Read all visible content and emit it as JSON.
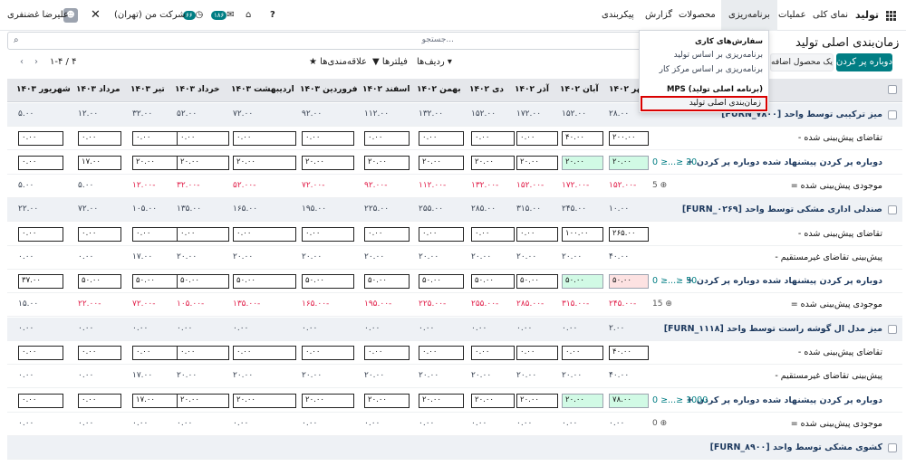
{
  "topbar": {
    "app_name": "تولید",
    "menus": [
      "نمای کلی",
      "عملیات",
      "برنامه‌ریزی",
      "محصولات",
      "گزارش",
      "پیکربندی"
    ],
    "user": "علیرضا غضنفری",
    "company": "شرکت من (تهران)",
    "badge_activity": "۶۶",
    "badge_msgs": "۱۸۶"
  },
  "page": {
    "title": "زمان‌بندی اصلی تولید",
    "search_placeholder": "جستجو...",
    "replenish_button": "دوباره پر کردن",
    "add_product_button": "یک محصول اضافه",
    "rows_label": "ردیف‌ها",
    "filters_label": "فیلترها",
    "favorites_label": "علاقه‌مندی‌ها",
    "pager": "۱-۴ / ۴"
  },
  "dropdown": {
    "header1": "سفارش‌های کاری",
    "item1": "برنامه‌ریزی بر اساس تولید",
    "item2": "برنامه‌ریزی بر اساس مرکز کار",
    "header2": "MPS (برنامه اصلی تولید)",
    "item3": "زمان‌بندی اصلی تولید"
  },
  "months": [
    "بهمن ۱۴۰۲",
    "آبان ۱۴۰۲",
    "آذر ۱۴۰۲",
    "دی ۱۴۰۲",
    "بهمن ۱۴۰۲",
    "اسفند ۱۴۰۲",
    "فروردین ۱۴۰۳",
    "اردیبهشت ۱۴۰۳",
    "خرداد ۱۴۰۳",
    "تیر ۱۴۰۳",
    "مرداد ۱۴۰۳",
    "شهریور ۱۴۰۳"
  ],
  "month0_visible": "مهر ۱۴۰۲",
  "rows": [
    {
      "type": "prod",
      "label": "[FURN_۷۸۰۰] میز ترکیبی توسط واحد",
      "values": [
        "۲۸.۰۰",
        "۱۵۲.۰۰",
        "۱۷۲.۰۰",
        "۱۵۲.۰۰",
        "۱۳۲.۰۰",
        "۱۱۲.۰۰",
        "۹۲.۰۰",
        "۷۲.۰۰",
        "۵۲.۰۰",
        "۳۲.۰۰",
        "۱۲.۰۰",
        "۵.۰۰"
      ]
    },
    {
      "type": "input",
      "label": "- تقاضای پیش‌بینی شده",
      "values": [
        "۲۰۰.۰۰",
        "۴۰.۰۰",
        "۰.۰۰",
        "۰.۰۰",
        "۰.۰۰",
        "۰.۰۰",
        "۰.۰۰",
        "۰.۰۰",
        "۰.۰۰",
        "۰.۰۰",
        "۰.۰۰",
        "۰.۰۰"
      ]
    },
    {
      "type": "repl",
      "label": "+ دوباره پر کردن پیشنهاد شده دوباره پر کردن",
      "minrep": "0 ≥...≥ 20",
      "values": [
        "۲۰.۰۰",
        "۲۰.۰۰",
        "۲۰.۰۰",
        "۲۰.۰۰",
        "۲۰.۰۰",
        "۲۰.۰۰",
        "۲۰.۰۰",
        "۲۰.۰۰",
        "۲۰.۰۰",
        "۲۰.۰۰",
        "۱۷.۰۰",
        "۰.۰۰"
      ],
      "style": [
        "green",
        "green",
        "",
        "",
        "",
        "",
        "",
        "",
        "",
        "",
        "",
        ""
      ]
    },
    {
      "type": "stock",
      "label": "= موجودی پیش‌بینی شده",
      "safety": "5",
      "values": [
        "۱۵۲.۰۰-",
        "۱۷۲.۰۰-",
        "۱۵۲.۰۰-",
        "۱۳۲.۰۰-",
        "۱۱۲.۰۰-",
        "۹۲.۰۰-",
        "۷۲.۰۰-",
        "۵۲.۰۰-",
        "۳۲.۰۰-",
        "۱۲.۰۰-",
        "۵.۰۰",
        "۵.۰۰"
      ],
      "red": [
        true,
        true,
        true,
        true,
        true,
        true,
        true,
        true,
        true,
        true,
        false,
        false
      ]
    },
    {
      "type": "prod",
      "label": "[FURN_۰۲۶۹] صندلی اداری مشکی توسط واحد",
      "values": [
        "۱۰.۰۰",
        "۲۴۵.۰۰",
        "۳۱۵.۰۰",
        "۲۸۵.۰۰",
        "۲۵۵.۰۰",
        "۲۲۵.۰۰",
        "۱۹۵.۰۰",
        "۱۶۵.۰۰",
        "۱۳۵.۰۰",
        "۱۰۵.۰۰",
        "۷۲.۰۰",
        "۲۲.۰۰"
      ]
    },
    {
      "type": "input",
      "label": "- تقاضای پیش‌بینی شده",
      "values": [
        "۲۶۵.۰۰",
        "۱۰۰.۰۰",
        "۰.۰۰",
        "۰.۰۰",
        "۰.۰۰",
        "۰.۰۰",
        "۰.۰۰",
        "۰.۰۰",
        "۰.۰۰",
        "۰.۰۰",
        "۰.۰۰",
        "۰.۰۰"
      ]
    },
    {
      "type": "text",
      "label": "- پیش‌بینی تقاضای غیرمستقیم",
      "values": [
        "۴۰.۰۰",
        "۲۰.۰۰",
        "۲۰.۰۰",
        "۲۰.۰۰",
        "۲۰.۰۰",
        "۲۰.۰۰",
        "۲۰.۰۰",
        "۲۰.۰۰",
        "۲۰.۰۰",
        "۱۷.۰۰",
        "۰.۰۰",
        "۰.۰۰"
      ]
    },
    {
      "type": "repl",
      "label": "+ دوباره پر کردن پیشنهاد شده دوباره پر کردن",
      "minrep": "0 ≥...≥ 50",
      "values": [
        "۵۰.۰۰",
        "۵۰.۰۰",
        "۵۰.۰۰",
        "۵۰.۰۰",
        "۵۰.۰۰",
        "۵۰.۰۰",
        "۵۰.۰۰",
        "۵۰.۰۰",
        "۵۰.۰۰",
        "۵۰.۰۰",
        "۵۰.۰۰",
        "۳۷.۰۰"
      ],
      "style": [
        "pink",
        "green",
        "",
        "",
        "",
        "",
        "",
        "",
        "",
        "",
        "",
        ""
      ]
    },
    {
      "type": "stock",
      "label": "= موجودی پیش‌بینی شده",
      "safety": "15",
      "values": [
        "۲۴۵.۰۰-",
        "۳۱۵.۰۰-",
        "۲۸۵.۰۰-",
        "۲۵۵.۰۰-",
        "۲۲۵.۰۰-",
        "۱۹۵.۰۰-",
        "۱۶۵.۰۰-",
        "۱۳۵.۰۰-",
        "۱۰۵.۰۰-",
        "۷۲.۰۰-",
        "۲۲.۰۰-",
        "۱۵.۰۰"
      ],
      "red": [
        true,
        true,
        true,
        true,
        true,
        true,
        true,
        true,
        true,
        true,
        true,
        false
      ]
    },
    {
      "type": "prod",
      "label": "[FURN_۱۱۱۸] میز مدل ال گوشه راست توسط واحد",
      "values": [
        "۲.۰۰",
        "۰.۰۰",
        "۰.۰۰",
        "۰.۰۰",
        "۰.۰۰",
        "۰.۰۰",
        "۰.۰۰",
        "۰.۰۰",
        "۰.۰۰",
        "۰.۰۰",
        "۰.۰۰",
        "۰.۰۰"
      ]
    },
    {
      "type": "input",
      "label": "- تقاضای پیش‌بینی شده",
      "values": [
        "۴۰.۰۰",
        "۰.۰۰",
        "۰.۰۰",
        "۰.۰۰",
        "۰.۰۰",
        "۰.۰۰",
        "۰.۰۰",
        "۰.۰۰",
        "۰.۰۰",
        "۰.۰۰",
        "۰.۰۰",
        "۰.۰۰"
      ]
    },
    {
      "type": "text",
      "label": "- پیش‌بینی تقاضای غیرمستقیم",
      "values": [
        "۴۰.۰۰",
        "۲۰.۰۰",
        "۲۰.۰۰",
        "۲۰.۰۰",
        "۲۰.۰۰",
        "۲۰.۰۰",
        "۲۰.۰۰",
        "۲۰.۰۰",
        "۲۰.۰۰",
        "۱۷.۰۰",
        "۰.۰۰",
        "۰.۰۰"
      ]
    },
    {
      "type": "repl",
      "label": "+ دوباره پر کردن پیشنهاد شده دوباره پر کردن",
      "minrep": "0 ≥...≥ 1000",
      "values": [
        "۷۸.۰۰",
        "۲۰.۰۰",
        "۲۰.۰۰",
        "۲۰.۰۰",
        "۲۰.۰۰",
        "۲۰.۰۰",
        "۲۰.۰۰",
        "۲۰.۰۰",
        "۲۰.۰۰",
        "۱۷.۰۰",
        "۰.۰۰",
        "۰.۰۰"
      ],
      "style": [
        "green",
        "green",
        "",
        "",
        "",
        "",
        "",
        "",
        "",
        "",
        "",
        ""
      ]
    },
    {
      "type": "stock",
      "label": "= موجودی پیش‌بینی شده",
      "safety": "0",
      "values": [
        "۰.۰۰",
        "۰.۰۰",
        "۰.۰۰",
        "۰.۰۰",
        "۰.۰۰",
        "۰.۰۰",
        "۰.۰۰",
        "۰.۰۰",
        "۰.۰۰",
        "۰.۰۰",
        "۰.۰۰",
        "۰.۰۰"
      ],
      "red": [
        false,
        false,
        false,
        false,
        false,
        false,
        false,
        false,
        false,
        false,
        false,
        false
      ]
    },
    {
      "type": "prod",
      "label": "[FURN_۸۹۰۰] کشوی مشکی توسط واحد",
      "values": [
        "",
        "",
        "",
        "",
        "",
        "",
        "",
        "",
        "",
        "",
        "",
        ""
      ]
    }
  ]
}
